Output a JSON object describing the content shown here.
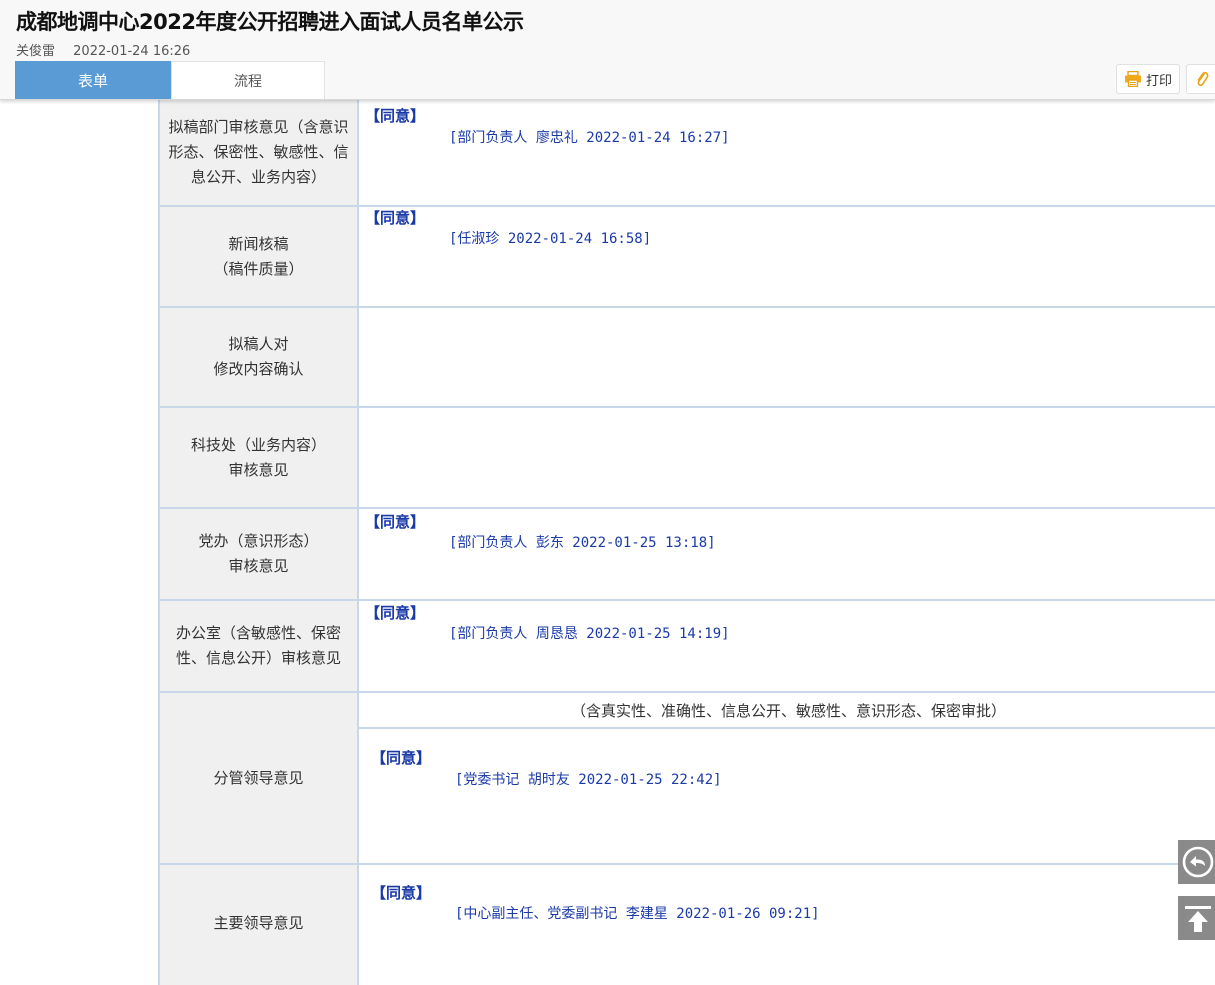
{
  "document": {
    "title": "成都地调中心2022年度公开招聘进入面试人员名单公示",
    "author": "关俊雷",
    "created_at": "2022-01-24 16:26"
  },
  "tabs": [
    {
      "label": "表单",
      "active": true
    },
    {
      "label": "流程",
      "active": false
    }
  ],
  "toolbar": {
    "print_label": "打印",
    "print_icon": "printer-icon",
    "attach_icon": "paperclip-icon"
  },
  "form": {
    "rows": [
      {
        "label": "拟稿部门审核意见（含意识形态、保密性、敏感性、信息公开、业务内容）",
        "opinion": "【同意】",
        "signature": "[部门负责人 廖忠礼 2022-01-24 16:27]"
      },
      {
        "label_lines": [
          "新闻核稿",
          "（稿件质量）"
        ],
        "opinion": "【同意】",
        "signature": "[任淑珍 2022-01-24 16:58]"
      },
      {
        "label_lines": [
          "拟稿人对",
          "修改内容确认"
        ],
        "opinion": "",
        "signature": ""
      },
      {
        "label_lines": [
          "科技处（业务内容）",
          "审核意见"
        ],
        "opinion": "",
        "signature": ""
      },
      {
        "label_lines": [
          "党办（意识形态）",
          "审核意见"
        ],
        "opinion": "【同意】",
        "signature": "[部门负责人 彭东 2022-01-25 13:18]"
      },
      {
        "label_lines": [
          "办公室（含敏感性、保密",
          "性、信息公开）审核意见"
        ],
        "opinion": "【同意】",
        "signature": "[部门负责人 周恳恳 2022-01-25 14:19]"
      },
      {
        "label": "分管领导意见",
        "note": "（含真实性、准确性、信息公开、敏感性、意识形态、保密审批）",
        "opinion": "【同意】",
        "signature": "[党委书记 胡时友 2022-01-25 22:42]"
      },
      {
        "label": "主要领导意见",
        "opinion": "【同意】",
        "signature": "[中心副主任、党委副书记 李建星 2022-01-26 09:21]"
      }
    ]
  },
  "float_tools": {
    "back_icon": "return-icon",
    "top_icon": "back-to-top-icon"
  },
  "colors": {
    "tab_active": "#5a9bd5",
    "opinion_text": "#1a3aa8",
    "table_border": "#c9d7ea",
    "label_bg": "#f0f0f0"
  }
}
